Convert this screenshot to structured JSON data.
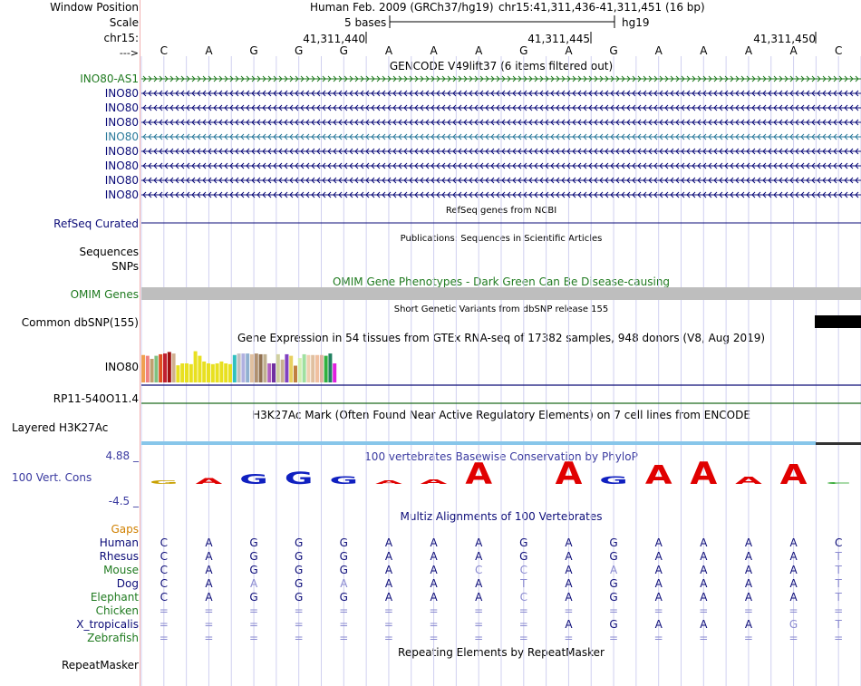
{
  "header": {
    "window_position_label": "Window Position",
    "scale_label": "Scale",
    "chrom_label": "chr15:",
    "strand_label": "--->",
    "assembly_title": "Human Feb. 2009 (GRCh37/hg19)",
    "position": "chr15:41,311,436-41,311,451 (16 bp)",
    "scale_text": "5 bases",
    "db": "hg19",
    "coord_ticks": [
      "41,311,440",
      "41,311,445",
      "41,311,450"
    ]
  },
  "bases": [
    "C",
    "A",
    "G",
    "G",
    "G",
    "A",
    "A",
    "A",
    "G",
    "A",
    "G",
    "A",
    "A",
    "A",
    "A",
    "C"
  ],
  "tracks": {
    "gencode": {
      "title": "GENCODE V49lift37 (6 items filtered out)",
      "items": [
        {
          "label": "INO80-AS1",
          "color": "#1f7a1f",
          "dir": ">"
        },
        {
          "label": "INO80",
          "color": "#0c0c78",
          "dir": "<"
        },
        {
          "label": "INO80",
          "color": "#0c0c78",
          "dir": "<"
        },
        {
          "label": "INO80",
          "color": "#0c0c78",
          "dir": "<"
        },
        {
          "label": "INO80",
          "color": "#2b7a9b",
          "dir": "<"
        },
        {
          "label": "INO80",
          "color": "#0c0c78",
          "dir": "<"
        },
        {
          "label": "INO80",
          "color": "#0c0c78",
          "dir": "<"
        },
        {
          "label": "INO80",
          "color": "#0c0c78",
          "dir": "<"
        },
        {
          "label": "INO80",
          "color": "#0c0c78",
          "dir": "<"
        }
      ]
    },
    "refseq": {
      "title": "RefSeq genes from NCBI",
      "label": "RefSeq Curated"
    },
    "publications": {
      "title": "Publications: Sequences in Scientific Articles",
      "label_seq": "Sequences",
      "label_snp": "SNPs"
    },
    "omim": {
      "title": "OMIM Gene Phenotypes - Dark Green Can Be Disease-causing",
      "label": "OMIM Genes"
    },
    "dbsnp": {
      "title": "Short Genetic Variants from dbSNP release 155",
      "label": "Common dbSNP(155)"
    },
    "gtex": {
      "title": "Gene Expression in 54 tissues from GTEx RNA-seq of 17382 samples, 948 donors (V8, Aug 2019)",
      "gene_label": "INO80",
      "bars": [
        {
          "v": 0.72,
          "c": "#f0a050"
        },
        {
          "v": 0.7,
          "c": "#f08080"
        },
        {
          "v": 0.62,
          "c": "#c0a070"
        },
        {
          "v": 0.7,
          "c": "#80c080"
        },
        {
          "v": 0.74,
          "c": "#e05020"
        },
        {
          "v": 0.76,
          "c": "#c02030"
        },
        {
          "v": 0.8,
          "c": "#a01010"
        },
        {
          "v": 0.76,
          "c": "#d0b090"
        },
        {
          "v": 0.45,
          "c": "#e8e020"
        },
        {
          "v": 0.5,
          "c": "#e8e020"
        },
        {
          "v": 0.5,
          "c": "#e8e020"
        },
        {
          "v": 0.48,
          "c": "#e8e020"
        },
        {
          "v": 0.82,
          "c": "#e8e020"
        },
        {
          "v": 0.7,
          "c": "#e8e020"
        },
        {
          "v": 0.55,
          "c": "#e8e020"
        },
        {
          "v": 0.5,
          "c": "#e8e020"
        },
        {
          "v": 0.48,
          "c": "#e8e020"
        },
        {
          "v": 0.5,
          "c": "#e8e020"
        },
        {
          "v": 0.55,
          "c": "#e8e020"
        },
        {
          "v": 0.5,
          "c": "#e8e020"
        },
        {
          "v": 0.48,
          "c": "#e8e020"
        },
        {
          "v": 0.72,
          "c": "#30c0c0"
        },
        {
          "v": 0.76,
          "c": "#c0c0c0"
        },
        {
          "v": 0.76,
          "c": "#b0b0e0"
        },
        {
          "v": 0.76,
          "c": "#90b0d0"
        },
        {
          "v": 0.74,
          "c": "#e0c0a0"
        },
        {
          "v": 0.76,
          "c": "#b09070"
        },
        {
          "v": 0.74,
          "c": "#907050"
        },
        {
          "v": 0.74,
          "c": "#c0b090"
        },
        {
          "v": 0.5,
          "c": "#b060c0"
        },
        {
          "v": 0.5,
          "c": "#7030a0"
        },
        {
          "v": 0.74,
          "c": "#d0d0a0"
        },
        {
          "v": 0.6,
          "c": "#c8b090"
        },
        {
          "v": 0.74,
          "c": "#8040c0"
        },
        {
          "v": 0.7,
          "c": "#e8d060"
        },
        {
          "v": 0.44,
          "c": "#c08040"
        },
        {
          "v": 0.64,
          "c": "#d0f0b0"
        },
        {
          "v": 0.74,
          "c": "#a0e0a0"
        },
        {
          "v": 0.72,
          "c": "#f0d0b0"
        },
        {
          "v": 0.72,
          "c": "#e0c0a0"
        },
        {
          "v": 0.72,
          "c": "#f0c0a0"
        },
        {
          "v": 0.72,
          "c": "#e0b0a0"
        },
        {
          "v": 0.7,
          "c": "#30b040"
        },
        {
          "v": 0.76,
          "c": "#208060"
        },
        {
          "v": 0.5,
          "c": "#e020e0"
        }
      ]
    },
    "rp11": {
      "label": "RP11-540O11.4"
    },
    "h3k27ac": {
      "title": "H3K27Ac Mark (Often Found Near Active Regulatory Elements) on 7 cell lines from ENCODE",
      "label": "Layered H3K27Ac",
      "color": "#87c6ea"
    },
    "phylop": {
      "title": "100 vertebrates Basewise Conservation by PhyloP",
      "label": "100 Vert. Cons",
      "max": "4.88 _",
      "min": "-4.5 _"
    },
    "multiz": {
      "title": "Multiz Alignments of 100 Vertebrates",
      "gaps_label": "Gaps",
      "species": [
        {
          "name": "Human",
          "color": "#0c0c78",
          "seq": [
            "C",
            "A",
            "G",
            "G",
            "G",
            "A",
            "A",
            "A",
            "G",
            "A",
            "G",
            "A",
            "A",
            "A",
            "A",
            "C"
          ],
          "faint": []
        },
        {
          "name": "Rhesus",
          "color": "#0c0c78",
          "seq": [
            "C",
            "A",
            "G",
            "G",
            "G",
            "A",
            "A",
            "A",
            "G",
            "A",
            "G",
            "A",
            "A",
            "A",
            "A",
            "T"
          ],
          "faint": [
            15
          ]
        },
        {
          "name": "Mouse",
          "color": "#1f7a1f",
          "seq": [
            "C",
            "A",
            "G",
            "G",
            "G",
            "A",
            "A",
            "C",
            "C",
            "A",
            "A",
            "A",
            "A",
            "A",
            "A",
            "T"
          ],
          "faint": [
            7,
            8,
            10,
            15
          ]
        },
        {
          "name": "Dog",
          "color": "#0c0c78",
          "seq": [
            "C",
            "A",
            "A",
            "G",
            "A",
            "A",
            "A",
            "A",
            "T",
            "A",
            "G",
            "A",
            "A",
            "A",
            "A",
            "T"
          ],
          "faint": [
            2,
            4,
            8,
            15
          ]
        },
        {
          "name": "Elephant",
          "color": "#1f7a1f",
          "seq": [
            "C",
            "A",
            "G",
            "G",
            "G",
            "A",
            "A",
            "A",
            "C",
            "A",
            "G",
            "A",
            "A",
            "A",
            "A",
            "T"
          ],
          "faint": [
            8,
            15
          ]
        },
        {
          "name": "Chicken",
          "color": "#1f7a1f",
          "seq": [
            "=",
            "=",
            "=",
            "=",
            "=",
            "=",
            "=",
            "=",
            "=",
            "=",
            "=",
            "=",
            "=",
            "=",
            "=",
            "="
          ],
          "faint": [
            0,
            1,
            2,
            3,
            4,
            5,
            6,
            7,
            8,
            9,
            10,
            11,
            12,
            13,
            14,
            15
          ]
        },
        {
          "name": "X_tropicalis",
          "color": "#0c0c78",
          "seq": [
            "=",
            "=",
            "=",
            "=",
            "=",
            "=",
            "=",
            "=",
            "=",
            "A",
            "G",
            "A",
            "A",
            "A",
            "G",
            "T"
          ],
          "faint": [
            0,
            1,
            2,
            3,
            4,
            5,
            6,
            7,
            8,
            14,
            15
          ]
        },
        {
          "name": "Zebrafish",
          "color": "#1f7a1f",
          "seq": [
            "=",
            "=",
            "=",
            "=",
            "=",
            "=",
            "=",
            "=",
            "=",
            "=",
            "=",
            "=",
            "=",
            "=",
            "=",
            "="
          ],
          "faint": [
            0,
            1,
            2,
            3,
            4,
            5,
            6,
            7,
            8,
            9,
            10,
            11,
            12,
            13,
            14,
            15
          ]
        }
      ]
    },
    "repeatmasker": {
      "title": "Repeating Elements by RepeatMasker",
      "label": "RepeatMasker"
    }
  },
  "conservation": [
    {
      "letter": "G",
      "h": 0.15,
      "c": "#c8a000"
    },
    {
      "letter": "A",
      "h": 0.25,
      "c": "#e00000"
    },
    {
      "letter": "G",
      "h": 0.45,
      "c": "#1020c0"
    },
    {
      "letter": "G",
      "h": 0.55,
      "c": "#1020c0"
    },
    {
      "letter": "G",
      "h": 0.35,
      "c": "#1020c0"
    },
    {
      "letter": "A",
      "h": 0.15,
      "c": "#e00000"
    },
    {
      "letter": "A",
      "h": 0.2,
      "c": "#e00000"
    },
    {
      "letter": "A",
      "h": 0.95,
      "c": "#e00000"
    },
    {
      "letter": "G",
      "h": 0.0,
      "c": "#1020c0"
    },
    {
      "letter": "A",
      "h": 1.0,
      "c": "#e00000"
    },
    {
      "letter": "G",
      "h": 0.35,
      "c": "#1020c0"
    },
    {
      "letter": "A",
      "h": 0.85,
      "c": "#e00000"
    },
    {
      "letter": "A",
      "h": 1.0,
      "c": "#e00000"
    },
    {
      "letter": "A",
      "h": 0.3,
      "c": "#e00000"
    },
    {
      "letter": "A",
      "h": 0.9,
      "c": "#e00000"
    },
    {
      "letter": "C",
      "h": 0.05,
      "c": "#20a020"
    }
  ]
}
